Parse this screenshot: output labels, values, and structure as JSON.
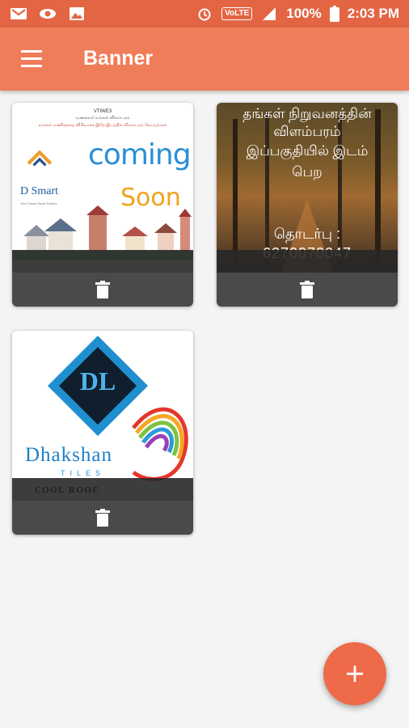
{
  "status_bar": {
    "volte": "VoLTE",
    "battery": "100%",
    "time": "2:03 PM",
    "icons": [
      "gmail-icon",
      "eye-icon",
      "image-icon",
      "alarm-icon",
      "volte-icon",
      "signal-icon",
      "battery-icon"
    ]
  },
  "app_bar": {
    "title": "Banner",
    "menu_icon": "hamburger-menu-icon"
  },
  "colors": {
    "status_bar": "#e36543",
    "app_bar": "#f07d59",
    "fab": "#ee6a48",
    "card_bar": "#4a4a4a",
    "background": "#f4f4f4"
  },
  "banners": [
    {
      "heading_small": "VTIWE3",
      "tiny_lines": [
        "வணக்கம்! உங்கள் விளம்பரம்",
        "உங்கள் வணிகத்தை விரிவாக்க இதே இடத்தில் விளம்பரம் செய்யுங்கள்"
      ],
      "brand": "D Smart",
      "brand_sub": "Your Smart Home Partner",
      "coming": "coming",
      "soon": "Soon",
      "delete_icon": "trash-icon"
    },
    {
      "lines": [
        "தங்கள் நிறுவனத்தின்",
        "விளம்பரம்",
        "இப்பகுதியில் இடம்",
        "பெற"
      ],
      "contact_label": "தொடர்பு :",
      "contact_number": "6270070047",
      "delete_icon": "trash-icon"
    },
    {
      "logo_letter": "DL",
      "brand": "Dhakshan",
      "tiles": "TILES",
      "cool_roof": "COOL ROOF",
      "delete_icon": "trash-icon"
    }
  ],
  "fab": {
    "label": "+",
    "icon": "plus-icon"
  }
}
